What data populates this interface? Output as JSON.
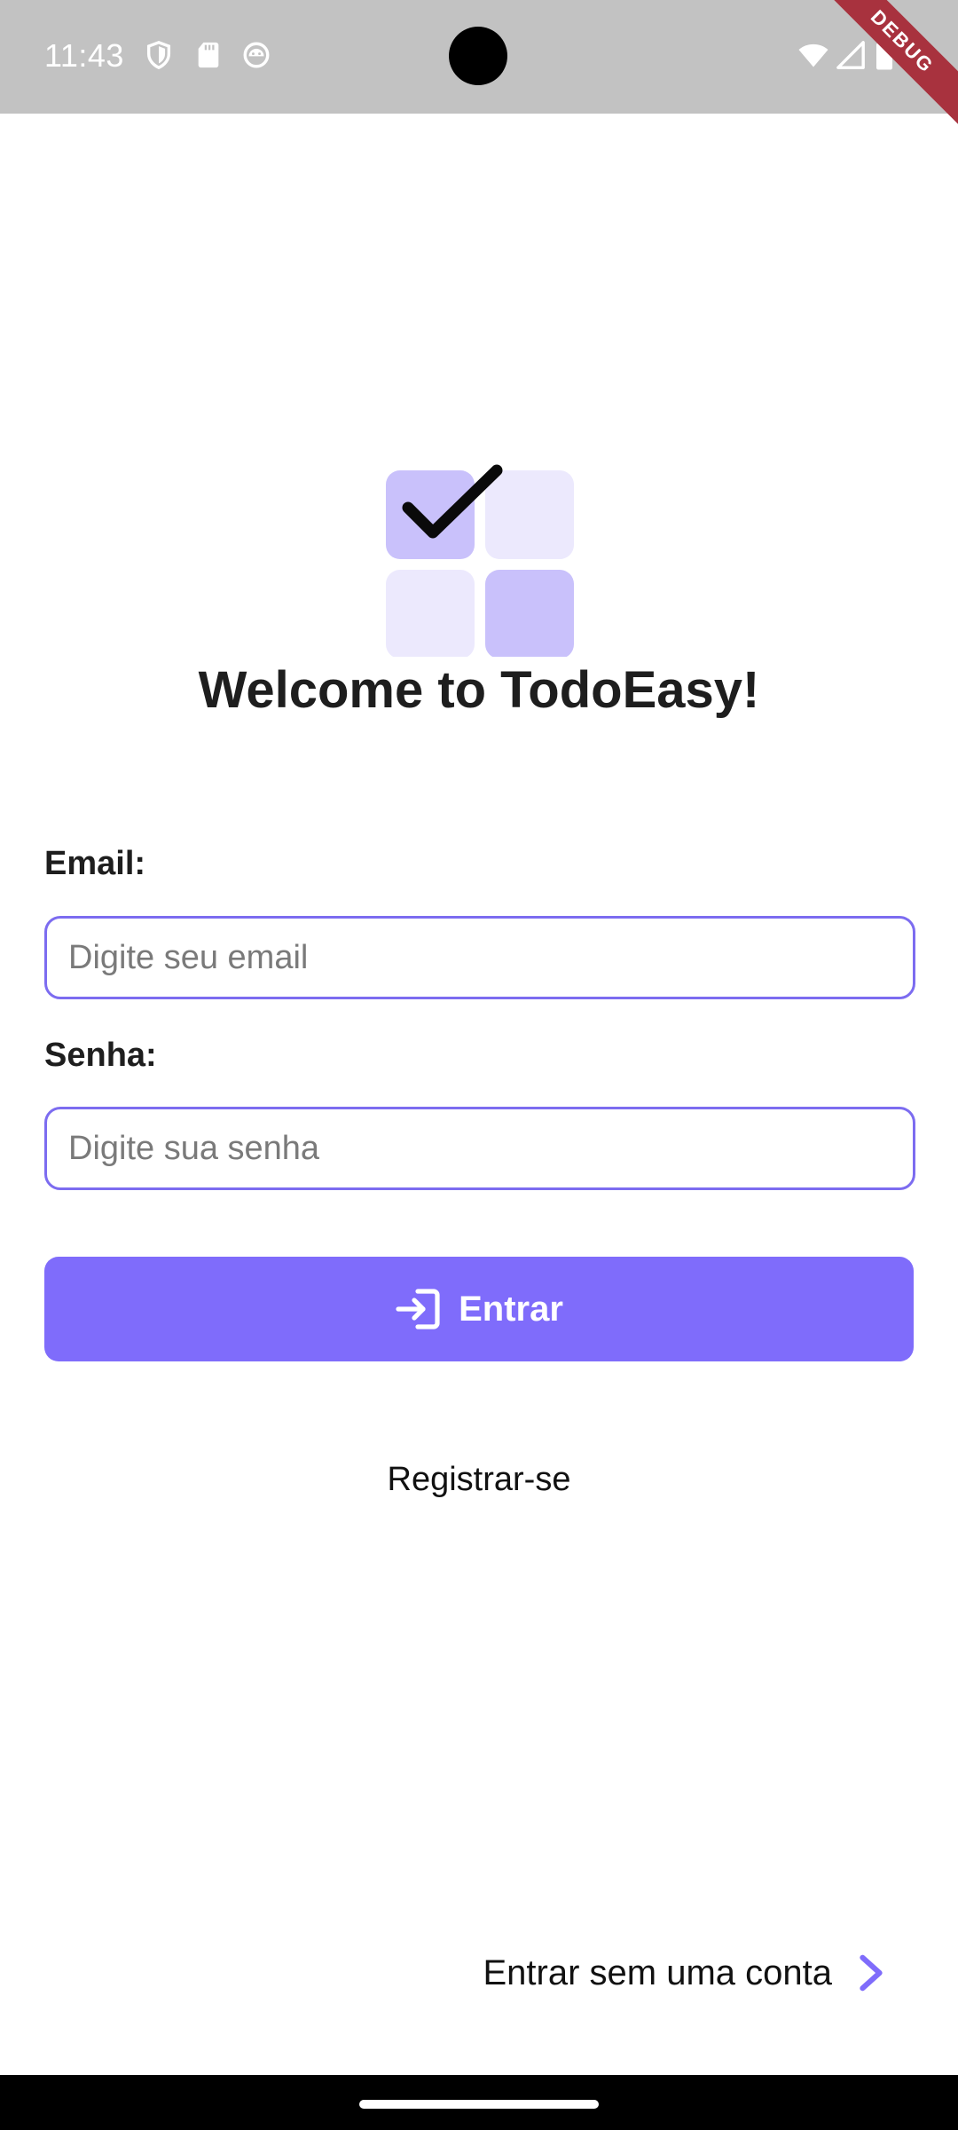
{
  "status_bar": {
    "time": "11:43",
    "icons": [
      "shield-icon",
      "sd-card-icon",
      "android-icon",
      "wifi-icon",
      "signal-icon",
      "battery-icon"
    ],
    "debug_label": "DEBUG"
  },
  "logo": {
    "icon": "checklist-grid-icon",
    "colors": {
      "primary_tile": "#c9c1fb",
      "light_tile": "#ece9fd",
      "check": "#0a0a0a"
    }
  },
  "title": "Welcome to TodoEasy!",
  "form": {
    "email": {
      "label": "Email:",
      "placeholder": "Digite seu email",
      "value": ""
    },
    "password": {
      "label": "Senha:",
      "placeholder": "Digite sua senha",
      "value": ""
    },
    "login_button": {
      "label": "Entrar",
      "icon": "login-icon"
    },
    "register_link": "Registrar-se"
  },
  "guest": {
    "label": "Entrar sem uma conta",
    "icon": "chevron-right-icon"
  },
  "colors": {
    "accent": "#7f6cfb",
    "border": "#7c6cf0",
    "status_bar": "#c2c2c2",
    "debug_ribbon": "#a8323e"
  }
}
